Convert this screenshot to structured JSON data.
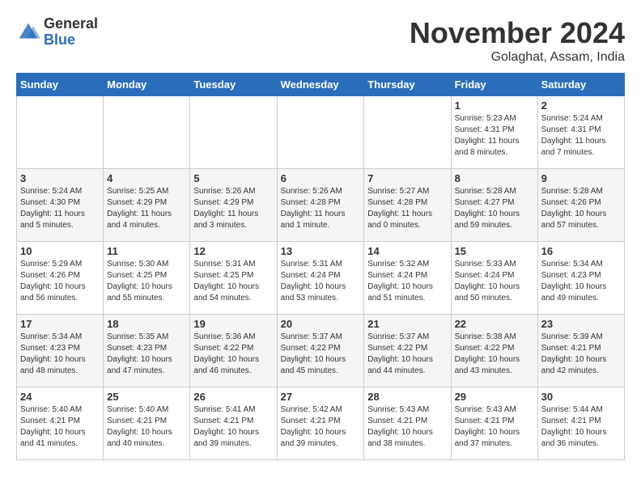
{
  "header": {
    "logo_general": "General",
    "logo_blue": "Blue",
    "month_title": "November 2024",
    "location": "Golaghat, Assam, India"
  },
  "days_of_week": [
    "Sunday",
    "Monday",
    "Tuesday",
    "Wednesday",
    "Thursday",
    "Friday",
    "Saturday"
  ],
  "weeks": [
    [
      {
        "num": "",
        "sunrise": "",
        "sunset": "",
        "daylight": ""
      },
      {
        "num": "",
        "sunrise": "",
        "sunset": "",
        "daylight": ""
      },
      {
        "num": "",
        "sunrise": "",
        "sunset": "",
        "daylight": ""
      },
      {
        "num": "",
        "sunrise": "",
        "sunset": "",
        "daylight": ""
      },
      {
        "num": "",
        "sunrise": "",
        "sunset": "",
        "daylight": ""
      },
      {
        "num": "1",
        "sunrise": "Sunrise: 5:23 AM",
        "sunset": "Sunset: 4:31 PM",
        "daylight": "Daylight: 11 hours and 8 minutes."
      },
      {
        "num": "2",
        "sunrise": "Sunrise: 5:24 AM",
        "sunset": "Sunset: 4:31 PM",
        "daylight": "Daylight: 11 hours and 7 minutes."
      }
    ],
    [
      {
        "num": "3",
        "sunrise": "Sunrise: 5:24 AM",
        "sunset": "Sunset: 4:30 PM",
        "daylight": "Daylight: 11 hours and 5 minutes."
      },
      {
        "num": "4",
        "sunrise": "Sunrise: 5:25 AM",
        "sunset": "Sunset: 4:29 PM",
        "daylight": "Daylight: 11 hours and 4 minutes."
      },
      {
        "num": "5",
        "sunrise": "Sunrise: 5:26 AM",
        "sunset": "Sunset: 4:29 PM",
        "daylight": "Daylight: 11 hours and 3 minutes."
      },
      {
        "num": "6",
        "sunrise": "Sunrise: 5:26 AM",
        "sunset": "Sunset: 4:28 PM",
        "daylight": "Daylight: 11 hours and 1 minute."
      },
      {
        "num": "7",
        "sunrise": "Sunrise: 5:27 AM",
        "sunset": "Sunset: 4:28 PM",
        "daylight": "Daylight: 11 hours and 0 minutes."
      },
      {
        "num": "8",
        "sunrise": "Sunrise: 5:28 AM",
        "sunset": "Sunset: 4:27 PM",
        "daylight": "Daylight: 10 hours and 59 minutes."
      },
      {
        "num": "9",
        "sunrise": "Sunrise: 5:28 AM",
        "sunset": "Sunset: 4:26 PM",
        "daylight": "Daylight: 10 hours and 57 minutes."
      }
    ],
    [
      {
        "num": "10",
        "sunrise": "Sunrise: 5:29 AM",
        "sunset": "Sunset: 4:26 PM",
        "daylight": "Daylight: 10 hours and 56 minutes."
      },
      {
        "num": "11",
        "sunrise": "Sunrise: 5:30 AM",
        "sunset": "Sunset: 4:25 PM",
        "daylight": "Daylight: 10 hours and 55 minutes."
      },
      {
        "num": "12",
        "sunrise": "Sunrise: 5:31 AM",
        "sunset": "Sunset: 4:25 PM",
        "daylight": "Daylight: 10 hours and 54 minutes."
      },
      {
        "num": "13",
        "sunrise": "Sunrise: 5:31 AM",
        "sunset": "Sunset: 4:24 PM",
        "daylight": "Daylight: 10 hours and 53 minutes."
      },
      {
        "num": "14",
        "sunrise": "Sunrise: 5:32 AM",
        "sunset": "Sunset: 4:24 PM",
        "daylight": "Daylight: 10 hours and 51 minutes."
      },
      {
        "num": "15",
        "sunrise": "Sunrise: 5:33 AM",
        "sunset": "Sunset: 4:24 PM",
        "daylight": "Daylight: 10 hours and 50 minutes."
      },
      {
        "num": "16",
        "sunrise": "Sunrise: 5:34 AM",
        "sunset": "Sunset: 4:23 PM",
        "daylight": "Daylight: 10 hours and 49 minutes."
      }
    ],
    [
      {
        "num": "17",
        "sunrise": "Sunrise: 5:34 AM",
        "sunset": "Sunset: 4:23 PM",
        "daylight": "Daylight: 10 hours and 48 minutes."
      },
      {
        "num": "18",
        "sunrise": "Sunrise: 5:35 AM",
        "sunset": "Sunset: 4:23 PM",
        "daylight": "Daylight: 10 hours and 47 minutes."
      },
      {
        "num": "19",
        "sunrise": "Sunrise: 5:36 AM",
        "sunset": "Sunset: 4:22 PM",
        "daylight": "Daylight: 10 hours and 46 minutes."
      },
      {
        "num": "20",
        "sunrise": "Sunrise: 5:37 AM",
        "sunset": "Sunset: 4:22 PM",
        "daylight": "Daylight: 10 hours and 45 minutes."
      },
      {
        "num": "21",
        "sunrise": "Sunrise: 5:37 AM",
        "sunset": "Sunset: 4:22 PM",
        "daylight": "Daylight: 10 hours and 44 minutes."
      },
      {
        "num": "22",
        "sunrise": "Sunrise: 5:38 AM",
        "sunset": "Sunset: 4:22 PM",
        "daylight": "Daylight: 10 hours and 43 minutes."
      },
      {
        "num": "23",
        "sunrise": "Sunrise: 5:39 AM",
        "sunset": "Sunset: 4:21 PM",
        "daylight": "Daylight: 10 hours and 42 minutes."
      }
    ],
    [
      {
        "num": "24",
        "sunrise": "Sunrise: 5:40 AM",
        "sunset": "Sunset: 4:21 PM",
        "daylight": "Daylight: 10 hours and 41 minutes."
      },
      {
        "num": "25",
        "sunrise": "Sunrise: 5:40 AM",
        "sunset": "Sunset: 4:21 PM",
        "daylight": "Daylight: 10 hours and 40 minutes."
      },
      {
        "num": "26",
        "sunrise": "Sunrise: 5:41 AM",
        "sunset": "Sunset: 4:21 PM",
        "daylight": "Daylight: 10 hours and 39 minutes."
      },
      {
        "num": "27",
        "sunrise": "Sunrise: 5:42 AM",
        "sunset": "Sunset: 4:21 PM",
        "daylight": "Daylight: 10 hours and 39 minutes."
      },
      {
        "num": "28",
        "sunrise": "Sunrise: 5:43 AM",
        "sunset": "Sunset: 4:21 PM",
        "daylight": "Daylight: 10 hours and 38 minutes."
      },
      {
        "num": "29",
        "sunrise": "Sunrise: 5:43 AM",
        "sunset": "Sunset: 4:21 PM",
        "daylight": "Daylight: 10 hours and 37 minutes."
      },
      {
        "num": "30",
        "sunrise": "Sunrise: 5:44 AM",
        "sunset": "Sunset: 4:21 PM",
        "daylight": "Daylight: 10 hours and 36 minutes."
      }
    ]
  ]
}
